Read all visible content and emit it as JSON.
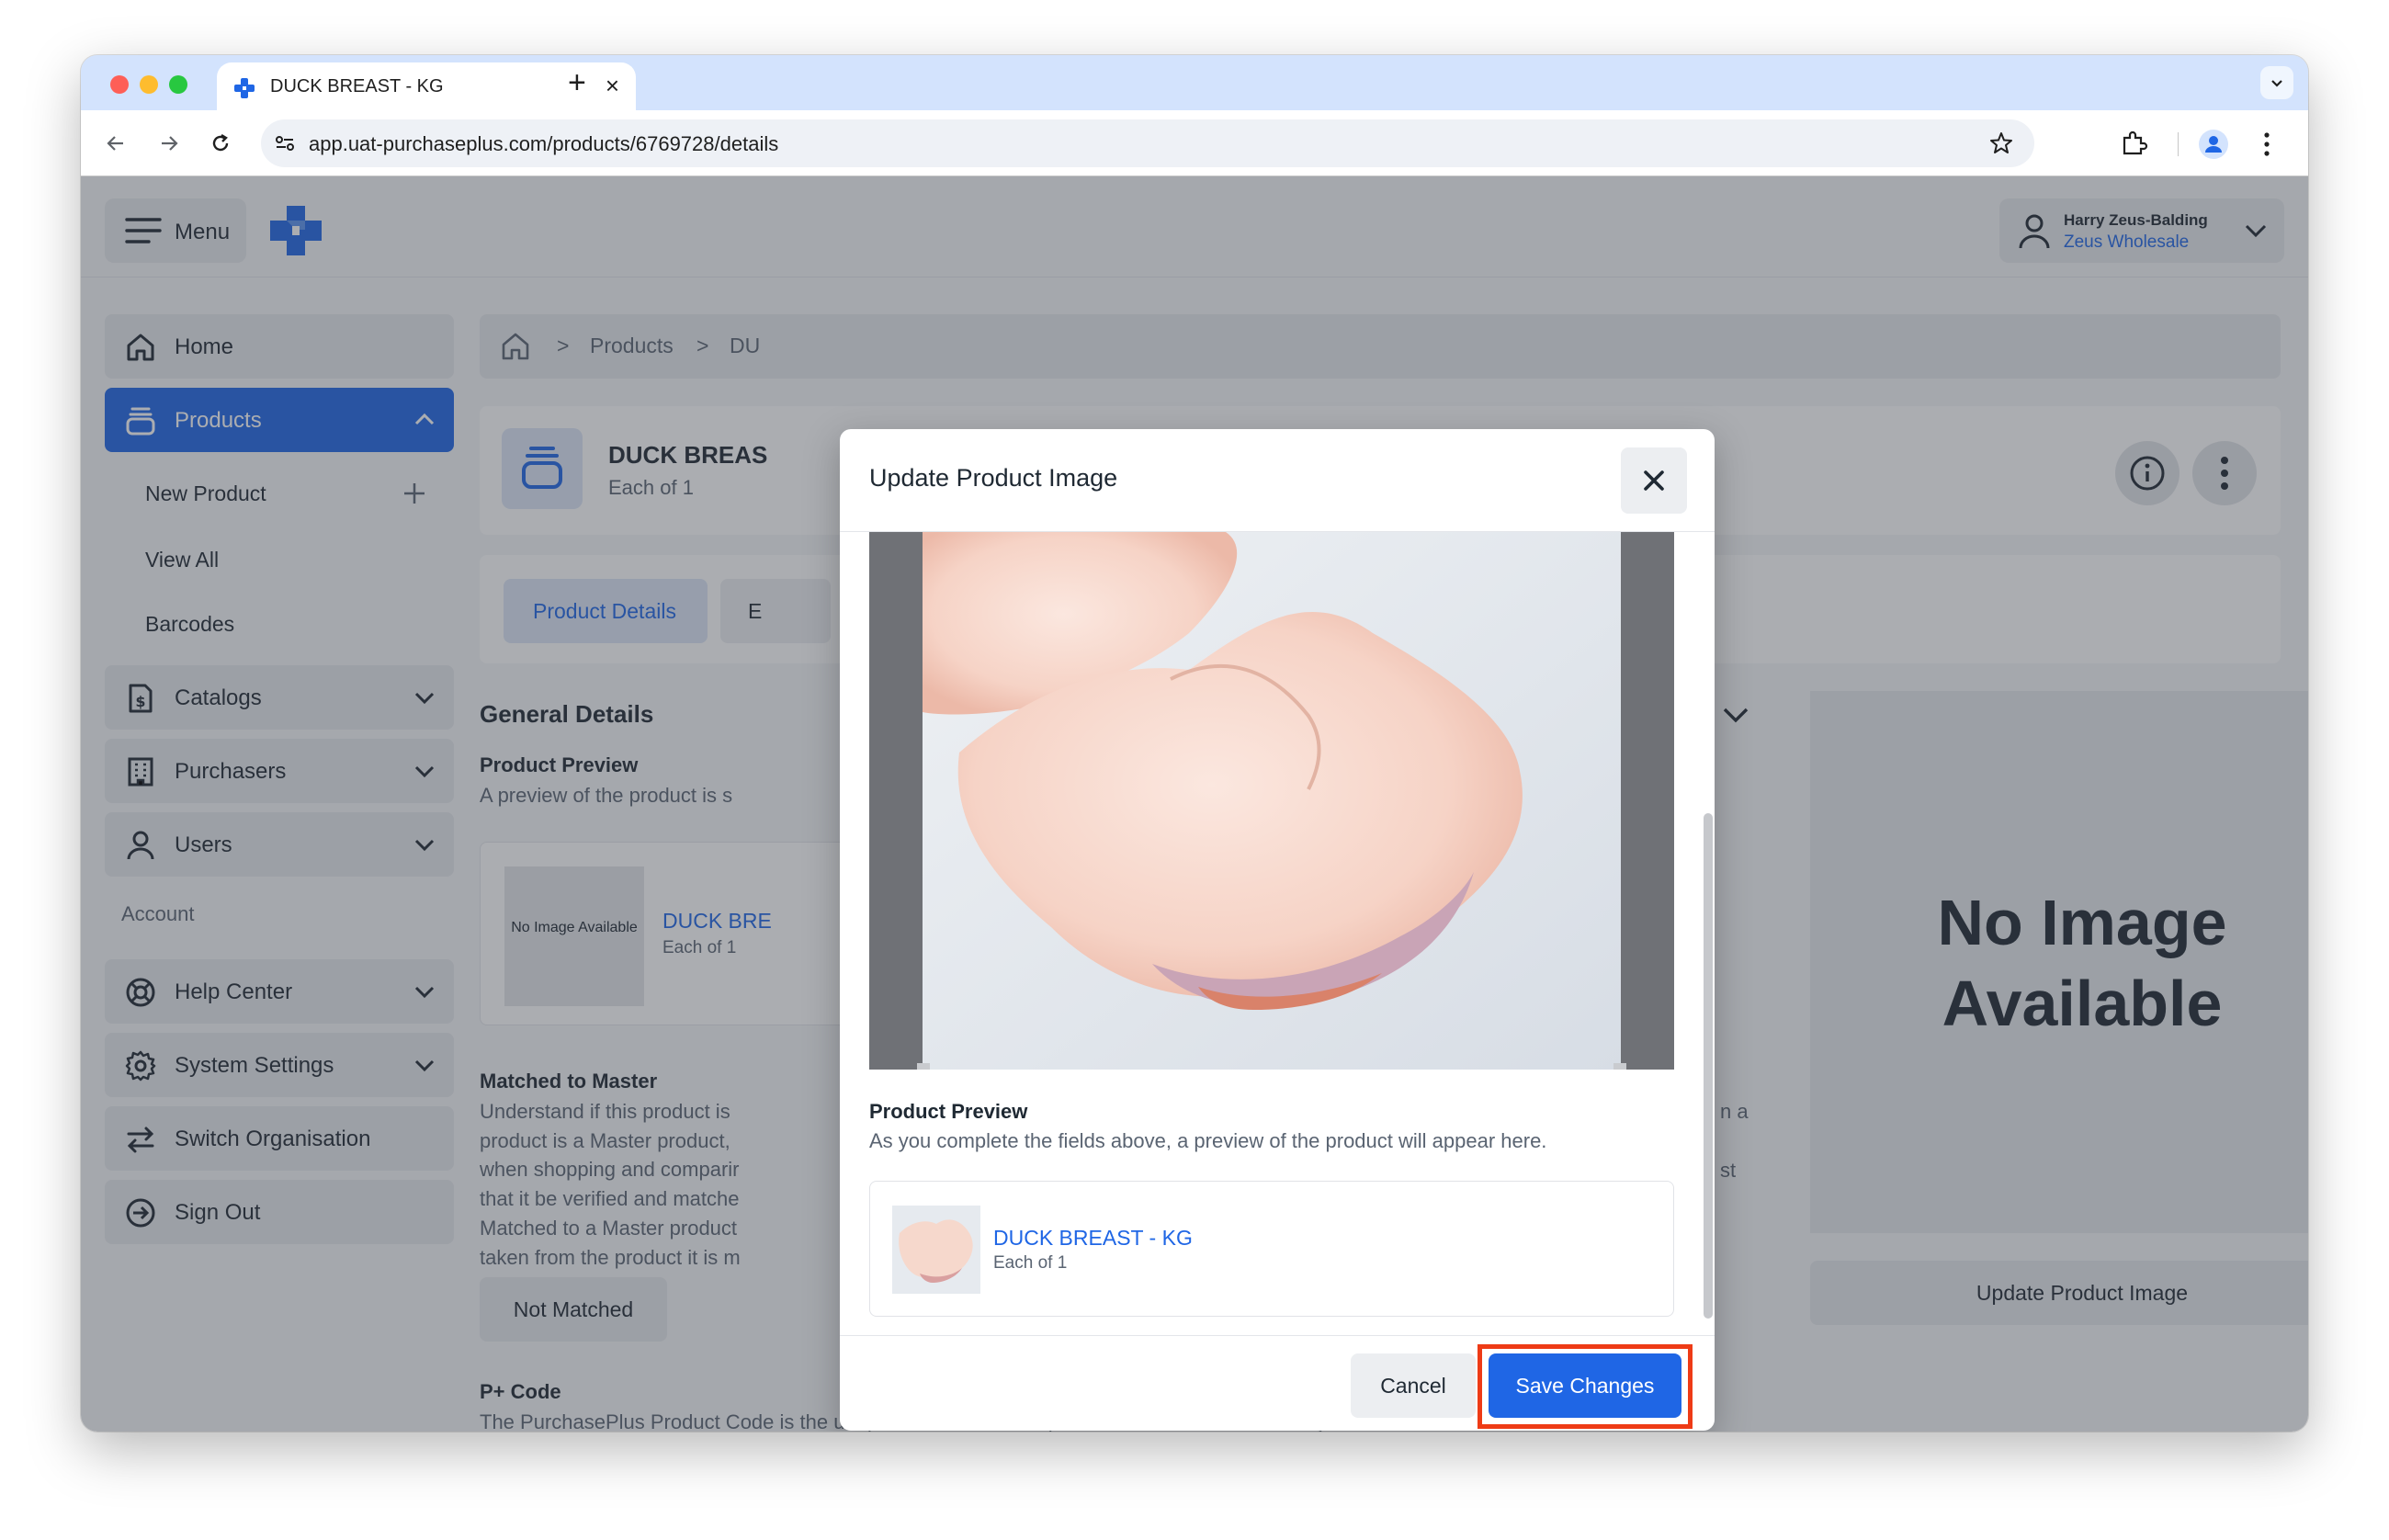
{
  "browser": {
    "tab_title": "DUCK BREAST - KG",
    "url": "app.uat-purchaseplus.com/products/6769728/details"
  },
  "header": {
    "menu_label": "Menu",
    "user_name": "Harry Zeus-Balding",
    "user_org": "Zeus Wholesale"
  },
  "sidebar": {
    "home": "Home",
    "products": "Products",
    "new_product": "New Product",
    "view_all": "View All",
    "barcodes": "Barcodes",
    "catalogs": "Catalogs",
    "purchasers": "Purchasers",
    "users": "Users",
    "account_heading": "Account",
    "help_center": "Help Center",
    "system_settings": "System Settings",
    "switch_org": "Switch Organisation",
    "sign_out": "Sign Out"
  },
  "breadcrumb": {
    "products": "Products",
    "current": "DU"
  },
  "product": {
    "title": "DUCK BREAS",
    "subtitle": "Each of 1"
  },
  "tabs": {
    "product_details": "Product Details",
    "second": "E"
  },
  "general": {
    "title": "General Details",
    "preview_title": "Product Preview",
    "preview_desc": "A preview of the product is s",
    "no_image_small": "No Image Available",
    "card_name": "DUCK BRE",
    "card_sub": "Each of 1",
    "matched_title": "Matched to Master",
    "matched_lines": [
      "Understand if this product is",
      "product is a Master product,",
      "when shopping and comparir",
      "that it be verified and matche",
      "Matched to a Master product",
      "taken from the product it is m"
    ],
    "right_frag_a": "n a",
    "right_frag_b": "st",
    "not_matched": "Not Matched",
    "pcode_title": "P+ Code",
    "pcode_desc": "The PurchasePlus Product Code is the unique identifier for this product in the PurchasePlus system. The P+ Code was set"
  },
  "image_panel": {
    "no_image": "No Image Available",
    "update_button": "Update Product Image"
  },
  "modal": {
    "title": "Update Product Image",
    "preview_title": "Product Preview",
    "preview_desc": "As you complete the fields above, a preview of the product will appear here.",
    "card_name": "DUCK BREAST - KG",
    "card_sub": "Each of 1",
    "cancel": "Cancel",
    "save": "Save Changes",
    "highlight_color": "#ee3b16"
  },
  "colors": {
    "brand": "#1f66e5",
    "tab_bar": "#d3e3fd"
  }
}
